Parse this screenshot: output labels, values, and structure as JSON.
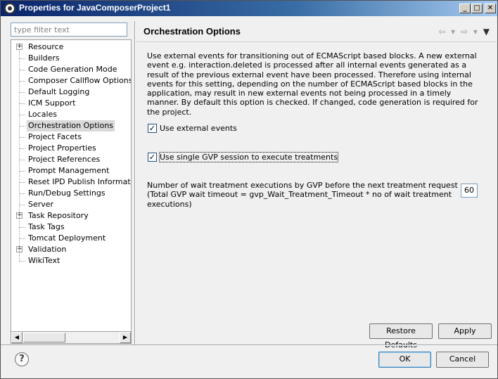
{
  "window": {
    "title": "Properties for JavaComposerProject1",
    "minimize": "_",
    "maximize": "□",
    "close": "✕"
  },
  "filter": {
    "placeholder": "type filter text"
  },
  "tree": {
    "items": [
      {
        "label": "Resource",
        "expandable": true,
        "expander": "+"
      },
      {
        "label": "Builders",
        "expandable": false
      },
      {
        "label": "Code Generation Mode",
        "expandable": false
      },
      {
        "label": "Composer Callflow Options",
        "expandable": false
      },
      {
        "label": "Default Logging",
        "expandable": false
      },
      {
        "label": "ICM Support",
        "expandable": false
      },
      {
        "label": "Locales",
        "expandable": false
      },
      {
        "label": "Orchestration Options",
        "expandable": false,
        "selected": true
      },
      {
        "label": "Project Facets",
        "expandable": false
      },
      {
        "label": "Project Properties",
        "expandable": false
      },
      {
        "label": "Project References",
        "expandable": false
      },
      {
        "label": "Prompt Management",
        "expandable": false
      },
      {
        "label": "Reset IPD Publish Information",
        "expandable": false
      },
      {
        "label": "Run/Debug Settings",
        "expandable": false
      },
      {
        "label": "Server",
        "expandable": false
      },
      {
        "label": "Task Repository",
        "expandable": true,
        "expander": "+"
      },
      {
        "label": "Task Tags",
        "expandable": false
      },
      {
        "label": "Tomcat Deployment",
        "expandable": false
      },
      {
        "label": "Validation",
        "expandable": true,
        "expander": "+"
      },
      {
        "label": "WikiText",
        "expandable": false
      }
    ],
    "scroll_left": "◀",
    "scroll_right": "▶"
  },
  "page": {
    "title": "Orchestration Options",
    "nav_back": "⇦",
    "nav_back_menu": "▾",
    "nav_forward": "⇨",
    "nav_forward_menu": "▾",
    "view_menu": "▼",
    "description": "Use external events for transitioning out of ECMAScript based blocks. A new external event e.g. interaction.deleted is processed after all internal events generated as a result of the previous external event have been processed. Therefore using internal events for this setting, depending on the number of ECMAScript based blocks in the application, may result in new external events not being processed in a timely manner. By default this option is checked. If changed, code generation is required for the project.",
    "checkbox_external": {
      "label": "Use external events",
      "checked": true,
      "mark": "✓"
    },
    "checkbox_gvp": {
      "label": "Use single GVP session to execute treatments",
      "checked": true,
      "mark": "✓"
    },
    "wait_label_line1": "Number of wait treatment executions by GVP before the next treatment request",
    "wait_label_line2": "(Total GVP wait timeout = gvp_Wait_Treatment_Timeout * no of wait treatment executions)",
    "wait_value": "60",
    "restore_defaults": "Restore Defaults",
    "apply": "Apply"
  },
  "footer": {
    "help": "?",
    "ok": "OK",
    "cancel": "Cancel"
  }
}
